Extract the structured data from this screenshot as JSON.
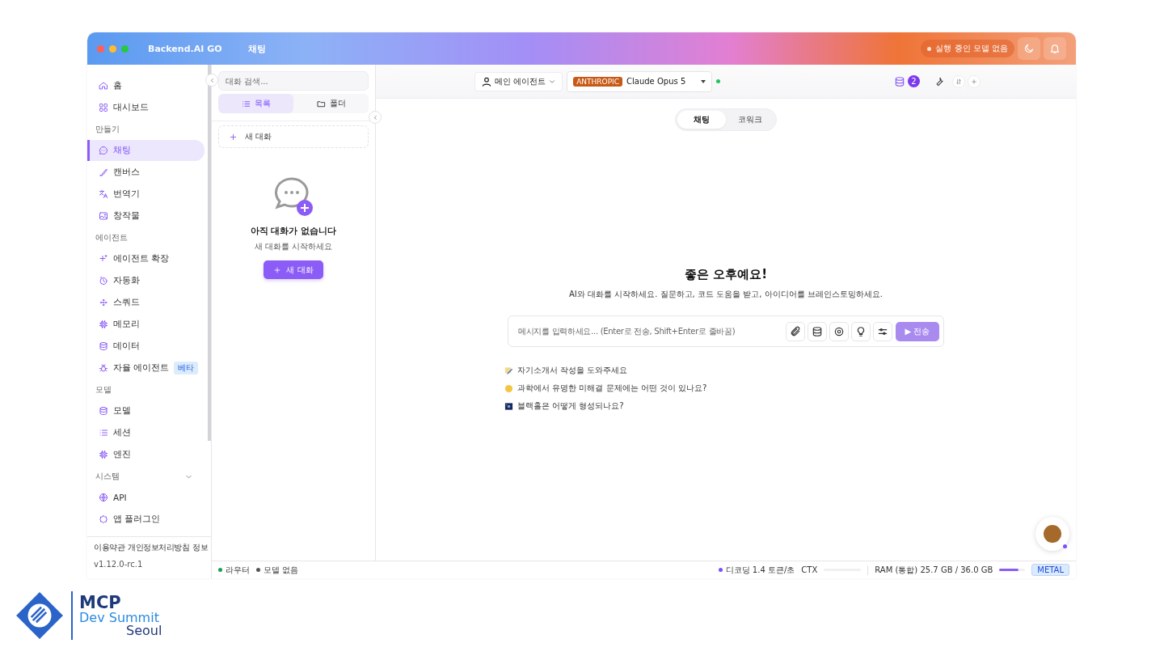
{
  "window": {
    "app_name": "Backend.AI GO",
    "title": "채팅",
    "status_pill": "실행 중인 모델 없음"
  },
  "sidebar": {
    "sections": [
      {
        "items": [
          {
            "label": "홈",
            "selected": false
          },
          {
            "label": "대시보드",
            "selected": false
          }
        ]
      },
      {
        "heading": "만들기",
        "items": [
          {
            "label": "채팅",
            "selected": true
          },
          {
            "label": "캔버스",
            "selected": false
          },
          {
            "label": "번역기",
            "selected": false
          },
          {
            "label": "창작물",
            "selected": false
          }
        ]
      },
      {
        "heading": "에이전트",
        "items": [
          {
            "label": "에이전트 확장",
            "selected": false
          },
          {
            "label": "자동화",
            "selected": false
          },
          {
            "label": "스쿼드",
            "selected": false
          },
          {
            "label": "메모리",
            "selected": false
          },
          {
            "label": "데이터",
            "selected": false
          },
          {
            "label": "자율 에이전트",
            "selected": false,
            "badge": "베타"
          }
        ]
      },
      {
        "heading": "모델",
        "items": [
          {
            "label": "모델",
            "selected": false
          },
          {
            "label": "세션",
            "selected": false
          },
          {
            "label": "엔진",
            "selected": false
          }
        ]
      },
      {
        "heading": "시스템",
        "expanded": true,
        "items": [
          {
            "label": "API",
            "selected": false
          },
          {
            "label": "앱 플러그인",
            "selected": false
          }
        ]
      }
    ],
    "footer_links": [
      "이용약관",
      "개인정보처리방침",
      "정보"
    ],
    "version": "v1.12.0-rc.1"
  },
  "conversations": {
    "search": {
      "placeholder": "대화 검색..."
    },
    "tabs": [
      {
        "label": "목록",
        "selected": true
      },
      {
        "label": "폴더",
        "selected": false
      }
    ],
    "new_button": "새 대화",
    "empty": {
      "title": "아직 대화가 없습니다",
      "subtitle": "새 대화를 시작하세요",
      "button": "새 대화"
    }
  },
  "topbar": {
    "agent": "메인 에이전트",
    "provider": "ANTHROPIC",
    "model": "Claude Opus 5",
    "model_online": true,
    "data_count": "2"
  },
  "mode_tabs": [
    {
      "label": "채팅",
      "selected": true
    },
    {
      "label": "코워크",
      "selected": false
    }
  ],
  "welcome": {
    "title": "좋은 오후예요!",
    "subtitle": "AI와 대화를 시작하세요. 질문하고, 코드 도움을 받고, 아이디어를 브레인스토밍하세요."
  },
  "composer": {
    "placeholder": "메시지를 입력하세요... (Enter로 전송, Shift+Enter로 줄바꿈)",
    "send": "▶ 전송",
    "send_disabled": true
  },
  "suggestions": [
    {
      "text": "자기소개서 작성을 도와주세요"
    },
    {
      "text": "과학에서 유명한 미해결 문제에는 어떤 것이 있나요?"
    },
    {
      "text": "블랙홀은 어떻게 형성되나요?"
    }
  ],
  "status_bar": {
    "left": [
      {
        "label": "라우터",
        "color": "#1f9d55"
      },
      {
        "label": "모델 없음",
        "color": "#555555"
      }
    ],
    "decoding": {
      "label": "디코딩 1.4 토큰/초",
      "color": "#7c4dff"
    },
    "ctx": {
      "label": "CTX",
      "level": 0
    },
    "ram": {
      "label": "RAM (통합) 25.7 GB / 36.0 GB",
      "level": 0.75
    },
    "backend": "METAL"
  },
  "slide_logo": {
    "line1": "MCP",
    "line2": "Dev Summit",
    "line3": "Seoul"
  }
}
